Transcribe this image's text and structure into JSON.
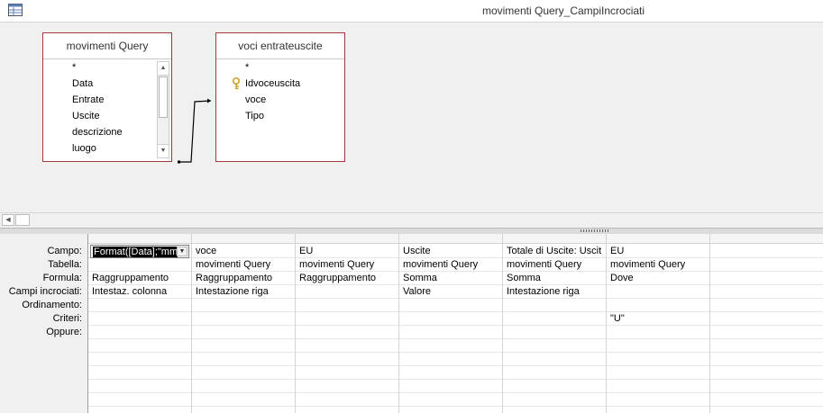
{
  "window": {
    "title": "movimenti Query_CampiIncrociati",
    "app_icon": "query-design-icon"
  },
  "tables": [
    {
      "name": "movimenti Query",
      "fields": [
        "*",
        "Data",
        "Entrate",
        "Uscite",
        "descrizione",
        "luogo"
      ]
    },
    {
      "name": "voci entrateuscite",
      "fields": [
        "*",
        "Idvoceuscita",
        "voce",
        "Tipo"
      ],
      "key_field": "Idvoceuscita"
    }
  ],
  "grid": {
    "row_labels": [
      "Campo:",
      "Tabella:",
      "Formula:",
      "Campi incrociati:",
      "Ordinamento:",
      "Criteri:",
      "Oppure:"
    ],
    "columns": [
      {
        "campo": "Format([Data];\"mmm",
        "tabella": "",
        "formula": "Raggruppamento",
        "campi_incrociati": "Intestaz. colonna",
        "ordinamento": "",
        "criteri": "",
        "oppure": ""
      },
      {
        "campo": "voce",
        "tabella": "movimenti Query",
        "formula": "Raggruppamento",
        "campi_incrociati": "Intestazione riga",
        "ordinamento": "",
        "criteri": "",
        "oppure": ""
      },
      {
        "campo": "EU",
        "tabella": "movimenti Query",
        "formula": "Raggruppamento",
        "campi_incrociati": "",
        "ordinamento": "",
        "criteri": "",
        "oppure": ""
      },
      {
        "campo": "Uscite",
        "tabella": "movimenti Query",
        "formula": "Somma",
        "campi_incrociati": "Valore",
        "ordinamento": "",
        "criteri": "",
        "oppure": ""
      },
      {
        "campo": "Totale di Uscite: Uscit",
        "tabella": "movimenti Query",
        "formula": "Somma",
        "campi_incrociati": "Intestazione riga",
        "ordinamento": "",
        "criteri": "",
        "oppure": ""
      },
      {
        "campo": "EU",
        "tabella": "movimenti Query",
        "formula": "Dove",
        "campi_incrociati": "",
        "ordinamento": "",
        "criteri": "\"U\"",
        "oppure": ""
      }
    ]
  }
}
